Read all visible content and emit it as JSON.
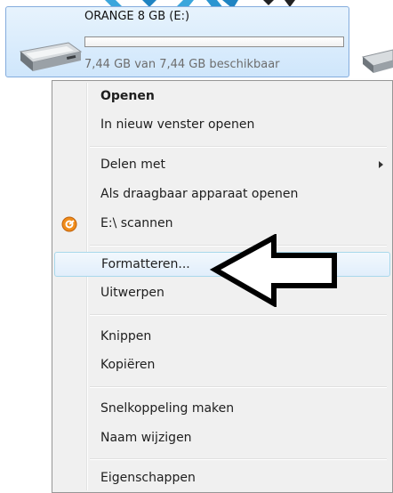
{
  "drive": {
    "name": "ORANGE 8 GB (E:)",
    "free_space": "7,44 GB van 7,44 GB beschikbaar",
    "used_fraction": 0,
    "icon": "usb-drive-icon"
  },
  "context_menu": {
    "items": [
      {
        "label": "Openen"
      },
      {
        "label": "In nieuw venster openen"
      },
      {
        "label": "Delen met"
      },
      {
        "label": "Als draagbaar apparaat openen"
      },
      {
        "label": "E:\\ scannen",
        "icon": "antivirus-scan-icon"
      },
      {
        "label": "Formatteren..."
      },
      {
        "label": "Uitwerpen"
      },
      {
        "label": "Knippen"
      },
      {
        "label": "Kopiëren"
      },
      {
        "label": "Snelkoppeling maken"
      },
      {
        "label": "Naam wijzigen"
      },
      {
        "label": "Eigenschappen"
      }
    ]
  },
  "colors": {
    "highlight_border": "#a8d8eb",
    "selection_tile": "#cfe6fb",
    "scan_icon": "#f08c1a"
  }
}
